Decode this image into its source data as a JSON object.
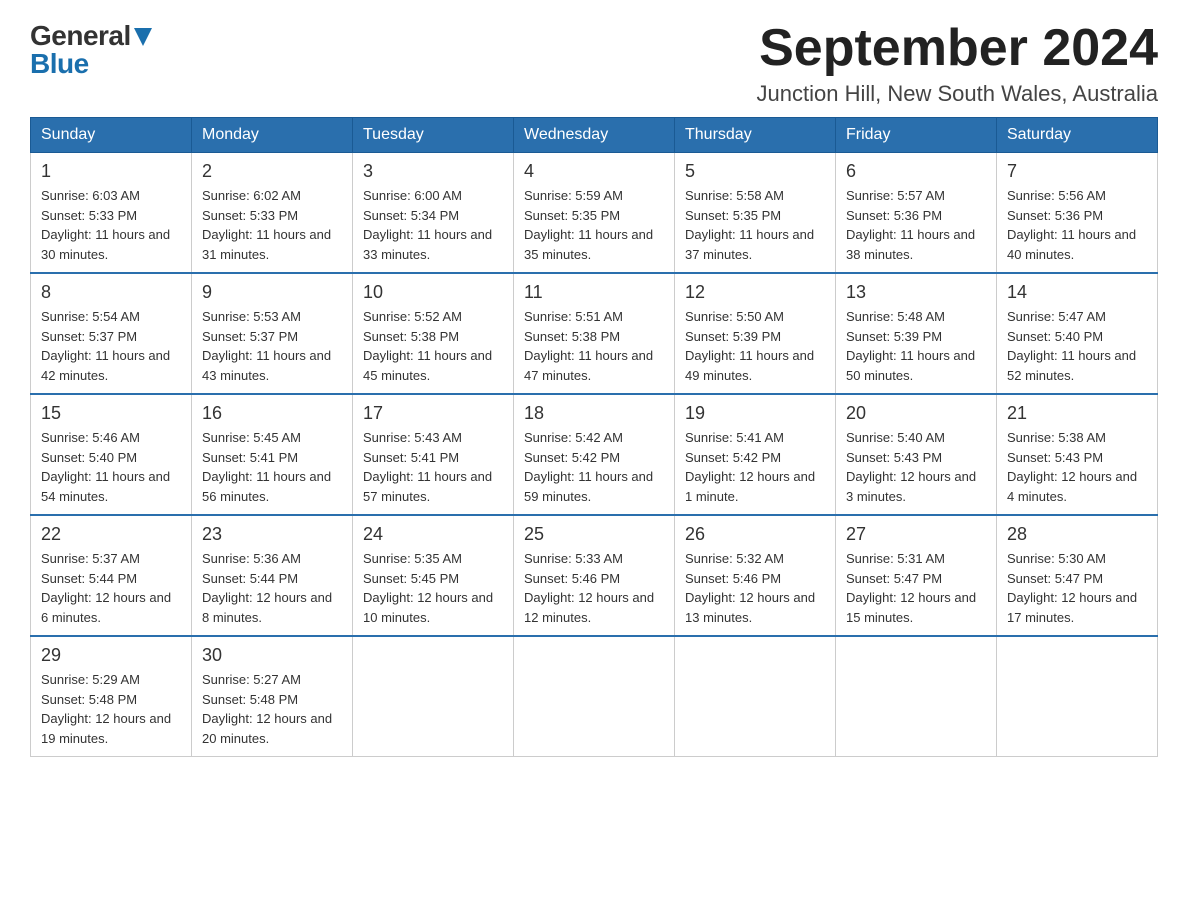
{
  "header": {
    "logo_general": "General",
    "logo_blue": "Blue",
    "title": "September 2024",
    "location": "Junction Hill, New South Wales, Australia"
  },
  "columns": [
    "Sunday",
    "Monday",
    "Tuesday",
    "Wednesday",
    "Thursday",
    "Friday",
    "Saturday"
  ],
  "weeks": [
    [
      {
        "day": "1",
        "sunrise": "6:03 AM",
        "sunset": "5:33 PM",
        "daylight": "11 hours and 30 minutes."
      },
      {
        "day": "2",
        "sunrise": "6:02 AM",
        "sunset": "5:33 PM",
        "daylight": "11 hours and 31 minutes."
      },
      {
        "day": "3",
        "sunrise": "6:00 AM",
        "sunset": "5:34 PM",
        "daylight": "11 hours and 33 minutes."
      },
      {
        "day": "4",
        "sunrise": "5:59 AM",
        "sunset": "5:35 PM",
        "daylight": "11 hours and 35 minutes."
      },
      {
        "day": "5",
        "sunrise": "5:58 AM",
        "sunset": "5:35 PM",
        "daylight": "11 hours and 37 minutes."
      },
      {
        "day": "6",
        "sunrise": "5:57 AM",
        "sunset": "5:36 PM",
        "daylight": "11 hours and 38 minutes."
      },
      {
        "day": "7",
        "sunrise": "5:56 AM",
        "sunset": "5:36 PM",
        "daylight": "11 hours and 40 minutes."
      }
    ],
    [
      {
        "day": "8",
        "sunrise": "5:54 AM",
        "sunset": "5:37 PM",
        "daylight": "11 hours and 42 minutes."
      },
      {
        "day": "9",
        "sunrise": "5:53 AM",
        "sunset": "5:37 PM",
        "daylight": "11 hours and 43 minutes."
      },
      {
        "day": "10",
        "sunrise": "5:52 AM",
        "sunset": "5:38 PM",
        "daylight": "11 hours and 45 minutes."
      },
      {
        "day": "11",
        "sunrise": "5:51 AM",
        "sunset": "5:38 PM",
        "daylight": "11 hours and 47 minutes."
      },
      {
        "day": "12",
        "sunrise": "5:50 AM",
        "sunset": "5:39 PM",
        "daylight": "11 hours and 49 minutes."
      },
      {
        "day": "13",
        "sunrise": "5:48 AM",
        "sunset": "5:39 PM",
        "daylight": "11 hours and 50 minutes."
      },
      {
        "day": "14",
        "sunrise": "5:47 AM",
        "sunset": "5:40 PM",
        "daylight": "11 hours and 52 minutes."
      }
    ],
    [
      {
        "day": "15",
        "sunrise": "5:46 AM",
        "sunset": "5:40 PM",
        "daylight": "11 hours and 54 minutes."
      },
      {
        "day": "16",
        "sunrise": "5:45 AM",
        "sunset": "5:41 PM",
        "daylight": "11 hours and 56 minutes."
      },
      {
        "day": "17",
        "sunrise": "5:43 AM",
        "sunset": "5:41 PM",
        "daylight": "11 hours and 57 minutes."
      },
      {
        "day": "18",
        "sunrise": "5:42 AM",
        "sunset": "5:42 PM",
        "daylight": "11 hours and 59 minutes."
      },
      {
        "day": "19",
        "sunrise": "5:41 AM",
        "sunset": "5:42 PM",
        "daylight": "12 hours and 1 minute."
      },
      {
        "day": "20",
        "sunrise": "5:40 AM",
        "sunset": "5:43 PM",
        "daylight": "12 hours and 3 minutes."
      },
      {
        "day": "21",
        "sunrise": "5:38 AM",
        "sunset": "5:43 PM",
        "daylight": "12 hours and 4 minutes."
      }
    ],
    [
      {
        "day": "22",
        "sunrise": "5:37 AM",
        "sunset": "5:44 PM",
        "daylight": "12 hours and 6 minutes."
      },
      {
        "day": "23",
        "sunrise": "5:36 AM",
        "sunset": "5:44 PM",
        "daylight": "12 hours and 8 minutes."
      },
      {
        "day": "24",
        "sunrise": "5:35 AM",
        "sunset": "5:45 PM",
        "daylight": "12 hours and 10 minutes."
      },
      {
        "day": "25",
        "sunrise": "5:33 AM",
        "sunset": "5:46 PM",
        "daylight": "12 hours and 12 minutes."
      },
      {
        "day": "26",
        "sunrise": "5:32 AM",
        "sunset": "5:46 PM",
        "daylight": "12 hours and 13 minutes."
      },
      {
        "day": "27",
        "sunrise": "5:31 AM",
        "sunset": "5:47 PM",
        "daylight": "12 hours and 15 minutes."
      },
      {
        "day": "28",
        "sunrise": "5:30 AM",
        "sunset": "5:47 PM",
        "daylight": "12 hours and 17 minutes."
      }
    ],
    [
      {
        "day": "29",
        "sunrise": "5:29 AM",
        "sunset": "5:48 PM",
        "daylight": "12 hours and 19 minutes."
      },
      {
        "day": "30",
        "sunrise": "5:27 AM",
        "sunset": "5:48 PM",
        "daylight": "12 hours and 20 minutes."
      },
      null,
      null,
      null,
      null,
      null
    ]
  ],
  "labels": {
    "sunrise": "Sunrise:",
    "sunset": "Sunset:",
    "daylight": "Daylight:"
  }
}
